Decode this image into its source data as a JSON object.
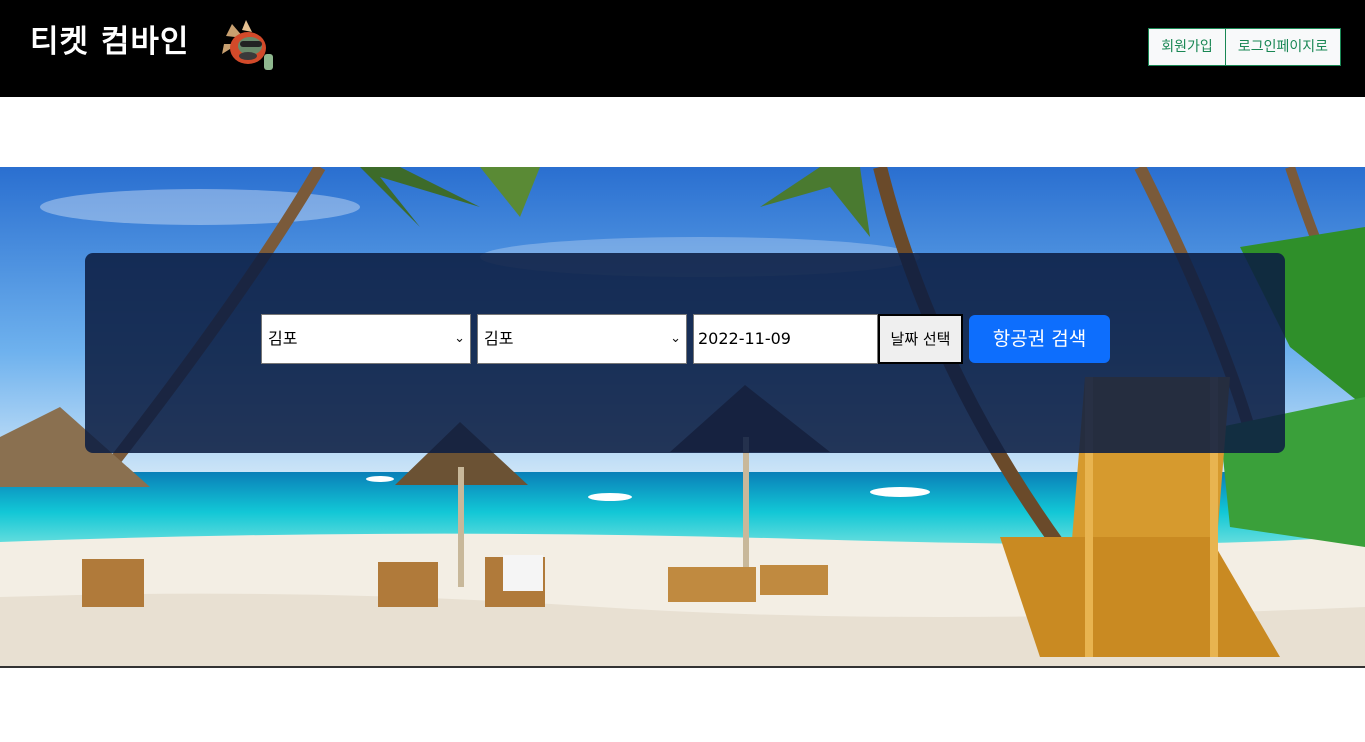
{
  "header": {
    "brand": "티켓 컴바인",
    "logo_icon": "mascot-logo-icon",
    "signup_label": "회원가입",
    "login_label": "로그인페이지로"
  },
  "search": {
    "origin": {
      "selected": "김포"
    },
    "destination": {
      "selected": "김포"
    },
    "date_value": "2022-11-09",
    "date_button": "날짜 선택",
    "submit_label": "항공권 검색"
  },
  "colors": {
    "header_bg": "#000000",
    "auth_border": "#198754",
    "primary": "#0d6efd",
    "panel_bg": "#0d1e42"
  }
}
